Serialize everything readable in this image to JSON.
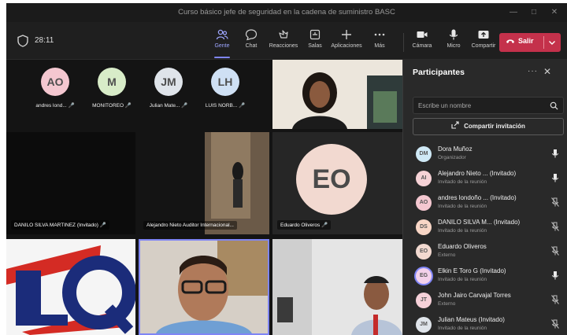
{
  "window": {
    "title": "Curso básico jefe de seguridad en la cadena de suministro BASC"
  },
  "toolbar": {
    "timer": "28:11",
    "buttons": [
      {
        "label": "Gente",
        "icon": "people-icon",
        "active": true
      },
      {
        "label": "Chat",
        "icon": "chat-icon"
      },
      {
        "label": "Reacciones",
        "icon": "reactions-icon"
      },
      {
        "label": "Salas",
        "icon": "rooms-icon"
      },
      {
        "label": "Aplicaciones",
        "icon": "apps-icon"
      },
      {
        "label": "Más",
        "icon": "more-icon"
      },
      {
        "label": "Cámara",
        "icon": "camera-icon"
      },
      {
        "label": "Micro",
        "icon": "mic-icon"
      },
      {
        "label": "Compartir",
        "icon": "share-icon"
      }
    ],
    "leave_label": "Salir"
  },
  "stage": {
    "avatars": [
      {
        "initials": "AO",
        "name": "andres lond...",
        "color": "#f4c7d0"
      },
      {
        "initials": "M",
        "name": "MONITOREO",
        "color": "#d8ecc8"
      },
      {
        "initials": "JM",
        "name": "Julian Mate...",
        "color": "#dfe4ea"
      },
      {
        "initials": "LH",
        "name": "LUIS NORB...",
        "color": "#cfe0f4"
      }
    ],
    "tiles": {
      "danilo": "DANILO SILVA MARTINEZ (Invitado)",
      "alejandro": "Alejandro Nieto Auditor Internacional...",
      "eduardo": {
        "initials": "EO",
        "name": "Eduardo Oliveros"
      }
    }
  },
  "panel": {
    "title": "Participantes",
    "search_placeholder": "Escribe un nombre",
    "invite_label": "Compartir invitación",
    "participants": [
      {
        "initials": "DM",
        "name": "Dora Muñoz",
        "role": "Organizador",
        "color": "#cfe9f6",
        "mic": "on"
      },
      {
        "initials": "AI",
        "name": "Alejandro Nieto ... (Invitado)",
        "role": "Invitado de la reunión",
        "color": "#f6d2d6",
        "mic": "on"
      },
      {
        "initials": "AO",
        "name": "andres londoño ... (Invitado)",
        "role": "Invitado de la reunión",
        "color": "#f4c7d0",
        "mic": "off"
      },
      {
        "initials": "DS",
        "name": "DANILO SILVA M... (Invitado)",
        "role": "Invitado de la reunión",
        "color": "#f8d6c6",
        "mic": "off"
      },
      {
        "initials": "EO",
        "name": "Eduardo Oliveros",
        "role": "Externo",
        "color": "#f2d9d0",
        "mic": "off"
      },
      {
        "initials": "EG",
        "name": "Elkin E Toro G (Invitado)",
        "role": "Invitado de la reunión",
        "color": "#f3d1ea",
        "mic": "on"
      },
      {
        "initials": "JT",
        "name": "John Jairo Carvajal Torres",
        "role": "Externo",
        "color": "#f6d1d9",
        "mic": "off"
      },
      {
        "initials": "JM",
        "name": "Julian Mateus (Invitado)",
        "role": "Invitado de la reunión",
        "color": "#dfe4ea",
        "mic": "off"
      }
    ]
  }
}
